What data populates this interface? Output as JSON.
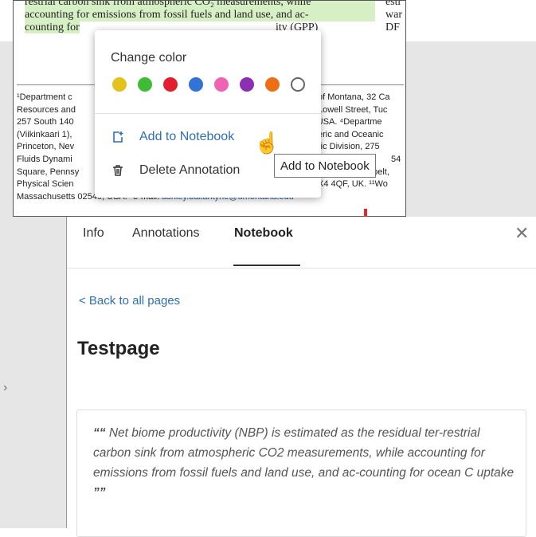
{
  "document": {
    "lines": [
      "restrial carbon sink from atmospheric CO₂ measurements, while",
      "accounting for emissions from fossil fuels and land use, and ac-",
      "counting for"
    ],
    "gpp_fragment": "ity (GPP)",
    "right_column": [
      "estr",
      "war",
      "DF"
    ],
    "footnotes_left": [
      "¹Department c",
      "Resources and",
      "257 South 140",
      "(Viikinkaari 1),",
      "Princeton, Nev",
      "Fluids Dynami",
      "Square, Pennsy",
      "Physical Scien"
    ],
    "footnotes_right": [
      "of Montana, 32 Ca",
      "Lowell Street, Tuc",
      "), USA. ⁴Departme",
      "eric and Oceanic",
      "ric Division, 275",
      "54",
      "Center, Greenbelt,",
      "X4 4QF, UK. ¹¹Wo"
    ],
    "footnote_last_prefix": "Massachusetts 02540, USA. *e-mail: ",
    "footnote_email": "ashley.ballantyne@umontana.edu"
  },
  "popup": {
    "change_color_label": "Change color",
    "colors": [
      {
        "name": "yellow",
        "hex": "#e3c21c"
      },
      {
        "name": "green",
        "hex": "#3fbb36"
      },
      {
        "name": "red",
        "hex": "#e21f2f"
      },
      {
        "name": "blue",
        "hex": "#2f74d6"
      },
      {
        "name": "pink",
        "hex": "#f062b4"
      },
      {
        "name": "purple",
        "hex": "#8c2fb3"
      },
      {
        "name": "orange",
        "hex": "#ee6f13"
      },
      {
        "name": "none",
        "hex": "#ffffff"
      }
    ],
    "add_to_notebook": "Add to Notebook",
    "delete_annotation": "Delete Annotation",
    "tooltip": "Add to Notebook"
  },
  "panel": {
    "tabs": [
      "Info",
      "Annotations",
      "Notebook"
    ],
    "active_tab": "Notebook",
    "close_glyph": "✕",
    "back_link": "< Back to all pages",
    "page_title": "Testpage",
    "quote": "Net biome productivity (NBP) is estimated as the residual ter-restrial carbon sink from atmospheric CO2 measurements, while accounting for emissions from fossil fuels and land use, and ac-counting for ocean C uptake"
  },
  "accent_color": "#e2282d",
  "link_color": "#2f6fb6"
}
